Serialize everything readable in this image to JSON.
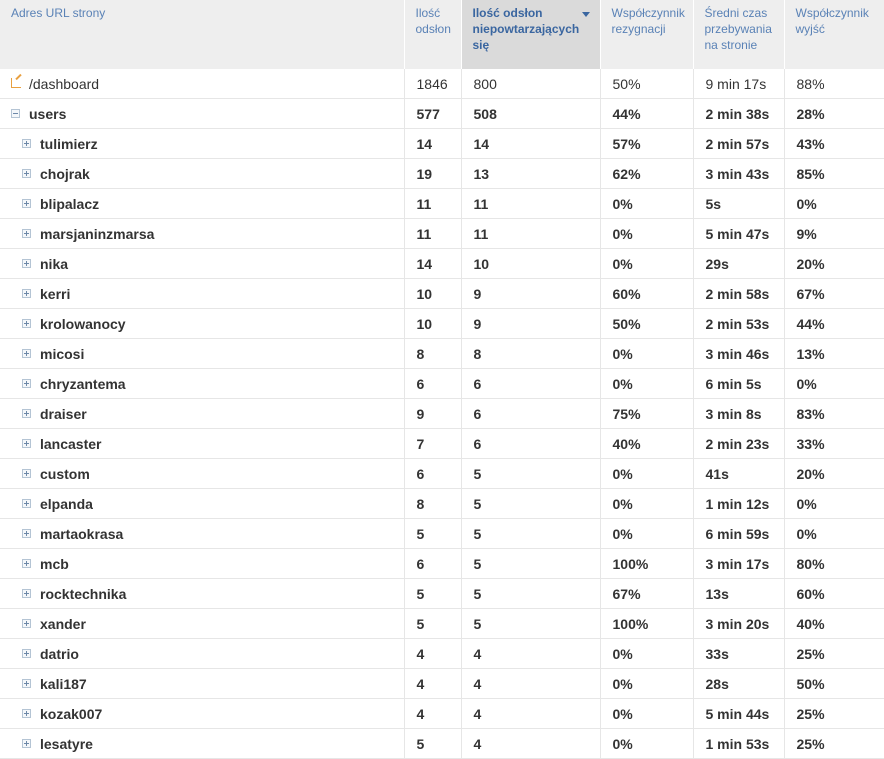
{
  "columns": [
    "Adres URL strony",
    "Ilość odsłon",
    "Ilość odsłon niepowtarzających się",
    "Współczynnik rezygnacji",
    "Średni czas przebywania na stronie",
    "Współczynnik wyjść"
  ],
  "sorted_column": 2,
  "rows": [
    {
      "type": "top",
      "page": "/dashboard",
      "views": "1846",
      "unique": "800",
      "bounce": "50%",
      "time": "9 min 17s",
      "exit": "88%"
    },
    {
      "type": "group",
      "page": "users",
      "views": "577",
      "unique": "508",
      "bounce": "44%",
      "time": "2 min 38s",
      "exit": "28%"
    },
    {
      "type": "child",
      "page": "tulimierz",
      "views": "14",
      "unique": "14",
      "bounce": "57%",
      "time": "2 min 57s",
      "exit": "43%"
    },
    {
      "type": "child",
      "page": "chojrak",
      "views": "19",
      "unique": "13",
      "bounce": "62%",
      "time": "3 min 43s",
      "exit": "85%"
    },
    {
      "type": "child",
      "page": "blipalacz",
      "views": "11",
      "unique": "11",
      "bounce": "0%",
      "time": "5s",
      "exit": "0%"
    },
    {
      "type": "child",
      "page": "marsjaninzmarsa",
      "views": "11",
      "unique": "11",
      "bounce": "0%",
      "time": "5 min 47s",
      "exit": "9%"
    },
    {
      "type": "child",
      "page": "nika",
      "views": "14",
      "unique": "10",
      "bounce": "0%",
      "time": "29s",
      "exit": "20%"
    },
    {
      "type": "child",
      "page": "kerri",
      "views": "10",
      "unique": "9",
      "bounce": "60%",
      "time": "2 min 58s",
      "exit": "67%"
    },
    {
      "type": "child",
      "page": "krolowanocy",
      "views": "10",
      "unique": "9",
      "bounce": "50%",
      "time": "2 min 53s",
      "exit": "44%"
    },
    {
      "type": "child",
      "page": "micosi",
      "views": "8",
      "unique": "8",
      "bounce": "0%",
      "time": "3 min 46s",
      "exit": "13%"
    },
    {
      "type": "child",
      "page": "chryzantema",
      "views": "6",
      "unique": "6",
      "bounce": "0%",
      "time": "6 min 5s",
      "exit": "0%"
    },
    {
      "type": "child",
      "page": "draiser",
      "views": "9",
      "unique": "6",
      "bounce": "75%",
      "time": "3 min 8s",
      "exit": "83%"
    },
    {
      "type": "child",
      "page": "lancaster",
      "views": "7",
      "unique": "6",
      "bounce": "40%",
      "time": "2 min 23s",
      "exit": "33%"
    },
    {
      "type": "child",
      "page": "custom",
      "views": "6",
      "unique": "5",
      "bounce": "0%",
      "time": "41s",
      "exit": "20%"
    },
    {
      "type": "child",
      "page": "elpanda",
      "views": "8",
      "unique": "5",
      "bounce": "0%",
      "time": "1 min 12s",
      "exit": "0%"
    },
    {
      "type": "child",
      "page": "martaokrasa",
      "views": "5",
      "unique": "5",
      "bounce": "0%",
      "time": "6 min 59s",
      "exit": "0%"
    },
    {
      "type": "child",
      "page": "mcb",
      "views": "6",
      "unique": "5",
      "bounce": "100%",
      "time": "3 min 17s",
      "exit": "80%"
    },
    {
      "type": "child",
      "page": "rocktechnika",
      "views": "5",
      "unique": "5",
      "bounce": "67%",
      "time": "13s",
      "exit": "60%"
    },
    {
      "type": "child",
      "page": "xander",
      "views": "5",
      "unique": "5",
      "bounce": "100%",
      "time": "3 min 20s",
      "exit": "40%"
    },
    {
      "type": "child",
      "page": "datrio",
      "views": "4",
      "unique": "4",
      "bounce": "0%",
      "time": "33s",
      "exit": "25%"
    },
    {
      "type": "child",
      "page": "kali187",
      "views": "4",
      "unique": "4",
      "bounce": "0%",
      "time": "28s",
      "exit": "50%"
    },
    {
      "type": "child",
      "page": "kozak007",
      "views": "4",
      "unique": "4",
      "bounce": "0%",
      "time": "5 min 44s",
      "exit": "25%"
    },
    {
      "type": "child",
      "page": "lesatyre",
      "views": "5",
      "unique": "4",
      "bounce": "0%",
      "time": "1 min 53s",
      "exit": "25%"
    }
  ]
}
